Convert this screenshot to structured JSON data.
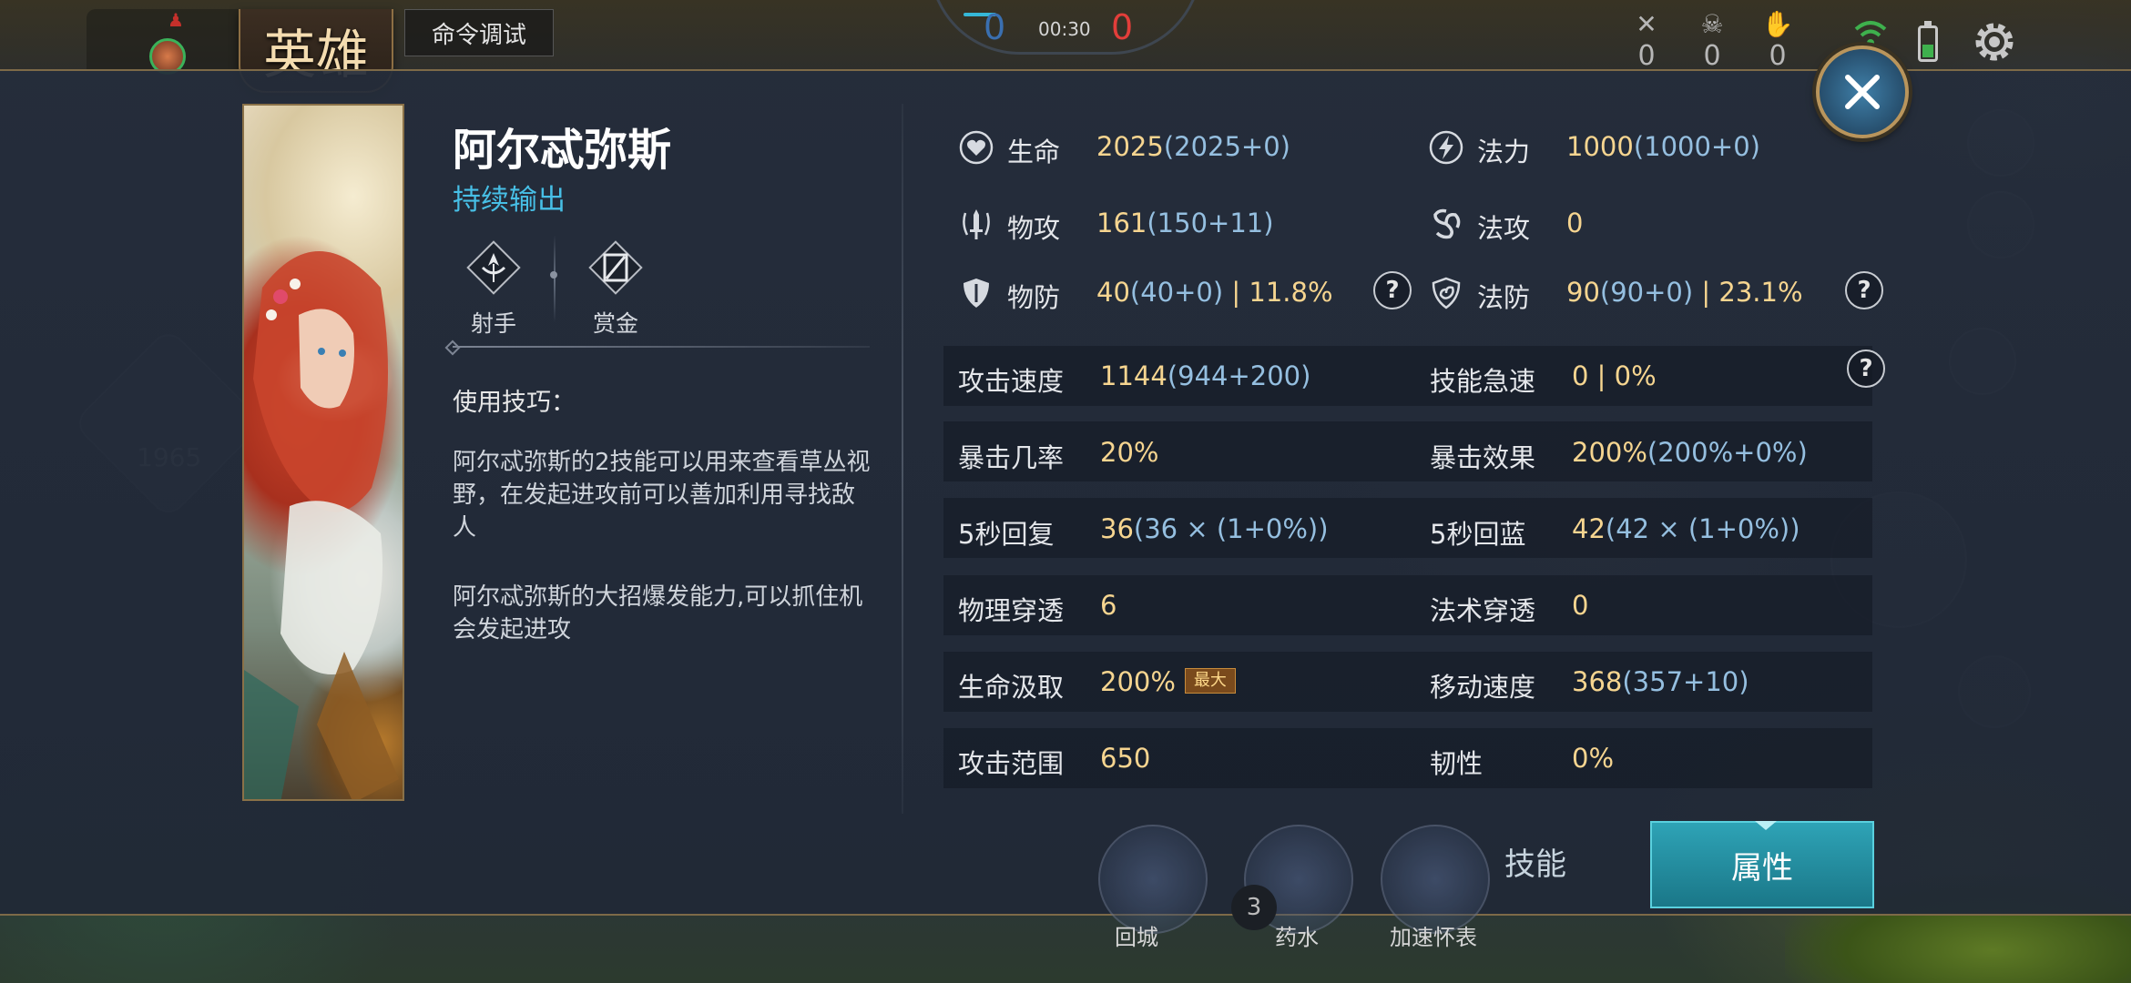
{
  "hud": {
    "score_blue": "0",
    "score_red": "0",
    "timer": "00:30",
    "kills": "0",
    "deaths": "0",
    "assists": "0",
    "command_debug": "命令调试",
    "minimap_gold": "1965",
    "bottom_recall": "回城",
    "bottom_potion": "药水",
    "bottom_clock": "加速怀表",
    "potion_count": "3"
  },
  "panel": {
    "title_badge": "英雄",
    "hero_name": "阿尔忒弥斯",
    "hero_role": "持续输出",
    "classes": [
      "射手",
      "赏金"
    ],
    "tips_title": "使用技巧：",
    "tips": [
      "阿尔忒弥斯的2技能可以用来查看草丛视野，在发起进攻前可以善加利用寻找敌人",
      "阿尔忒弥斯的大招爆发能力,可以抓住机会发起进攻"
    ],
    "tabs": {
      "skills": "技能",
      "attributes": "属性"
    }
  },
  "stats": {
    "hp": {
      "label": "生命",
      "main": "2025",
      "sub": "(2025+0)"
    },
    "mana": {
      "label": "法力",
      "main": "1000",
      "sub": "(1000+0)"
    },
    "patk": {
      "label": "物攻",
      "main": "161",
      "sub": "(150+11)"
    },
    "matk": {
      "label": "法攻",
      "main": "0",
      "sub": ""
    },
    "pdef": {
      "label": "物防",
      "main": "40",
      "sub": "(40+0)",
      "extra": " | 11.8%"
    },
    "mdef": {
      "label": "法防",
      "main": "90",
      "sub": "(90+0)",
      "extra": " | 23.1%"
    },
    "aspd": {
      "label": "攻击速度",
      "main": "1144",
      "sub": "(944+200)"
    },
    "haste": {
      "label": "技能急速",
      "main": "0 | 0%",
      "sub": ""
    },
    "crit": {
      "label": "暴击几率",
      "main": "20%",
      "sub": ""
    },
    "critdmg": {
      "label": "暴击效果",
      "main": "200%",
      "sub": "(200%+0%)"
    },
    "hp5": {
      "label": "5秒回复",
      "main": "36",
      "sub": "(36 × (1+0%))"
    },
    "mp5": {
      "label": "5秒回蓝",
      "main": "42",
      "sub": "(42 × (1+0%))"
    },
    "ppen": {
      "label": "物理穿透",
      "main": "6",
      "sub": ""
    },
    "mpen": {
      "label": "法术穿透",
      "main": "0",
      "sub": ""
    },
    "lifesteal": {
      "label": "生命汲取",
      "main": "200%",
      "badge": "最大"
    },
    "movespd": {
      "label": "移动速度",
      "main": "368",
      "sub": "(357+10)"
    },
    "range": {
      "label": "攻击范围",
      "main": "650",
      "sub": ""
    },
    "tenacity": {
      "label": "韧性",
      "main": "0%",
      "sub": ""
    }
  },
  "colors": {
    "value_gold": "#f6d590",
    "value_sub_blue": "#95bfe0",
    "role_cyan": "#47bfe6",
    "tab_active": "#2ea3b6"
  }
}
